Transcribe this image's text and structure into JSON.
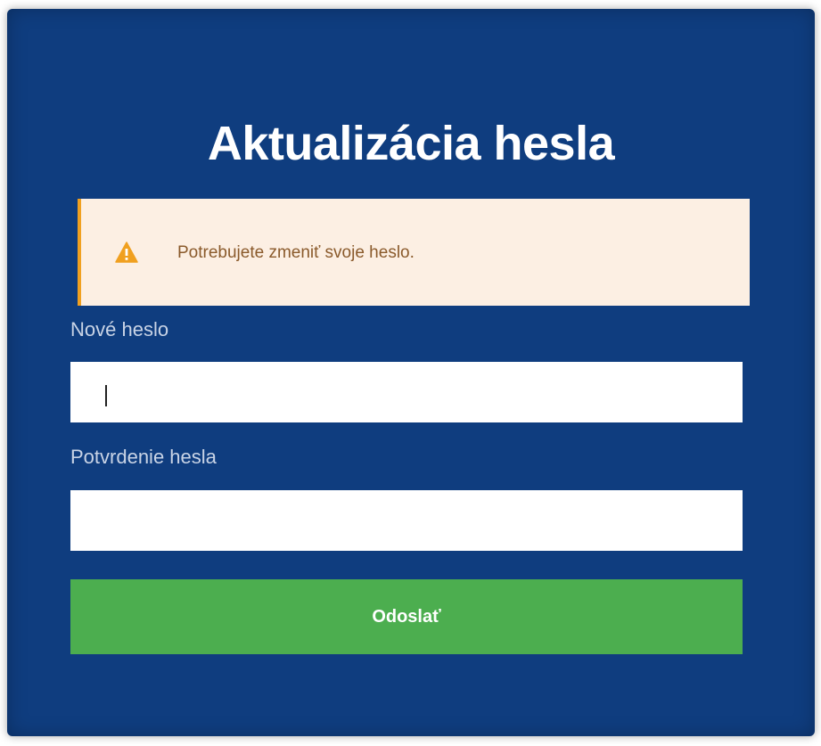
{
  "page": {
    "title": "Aktualizácia hesla"
  },
  "alert": {
    "message": "Potrebujete zmeniť svoje heslo.",
    "icon": "warning-icon",
    "accent_color": "#f0a020",
    "background_color": "#fcefe3"
  },
  "form": {
    "new_password": {
      "label": "Nové heslo",
      "value": ""
    },
    "confirm_password": {
      "label": "Potvrdenie hesla",
      "value": ""
    },
    "submit_label": "Odoslať"
  },
  "colors": {
    "card_background": "#0f3d7f",
    "submit_button": "#4cae4f"
  }
}
